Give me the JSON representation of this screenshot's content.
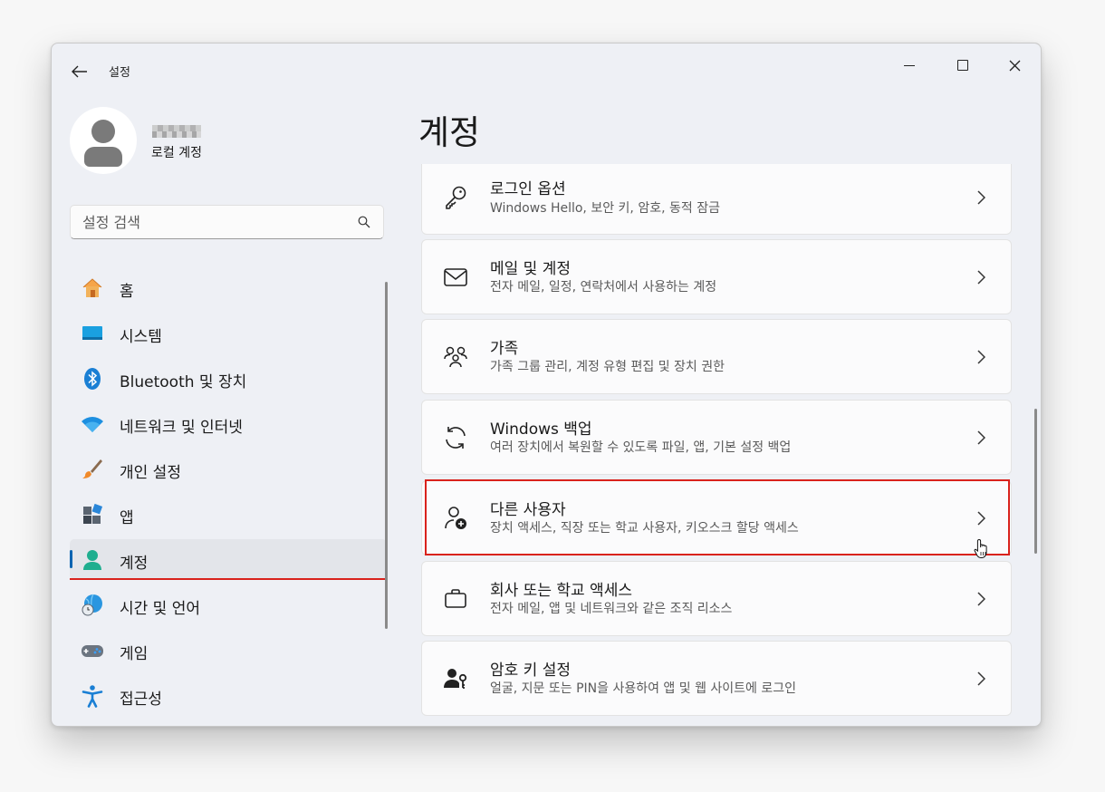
{
  "window": {
    "title": "설정"
  },
  "profile": {
    "account_type": "로컬 계정"
  },
  "search": {
    "placeholder": "설정 검색"
  },
  "nav": {
    "items": [
      {
        "label": "홈",
        "icon": "home-icon"
      },
      {
        "label": "시스템",
        "icon": "system-icon"
      },
      {
        "label": "Bluetooth 및 장치",
        "icon": "bluetooth-icon"
      },
      {
        "label": "네트워크 및 인터넷",
        "icon": "wifi-icon"
      },
      {
        "label": "개인 설정",
        "icon": "brush-icon"
      },
      {
        "label": "앱",
        "icon": "apps-icon"
      },
      {
        "label": "계정",
        "icon": "account-icon"
      },
      {
        "label": "시간 및 언어",
        "icon": "globe-clock-icon"
      },
      {
        "label": "게임",
        "icon": "gamepad-icon"
      },
      {
        "label": "접근성",
        "icon": "accessibility-icon"
      }
    ],
    "selected": "계정"
  },
  "page": {
    "title": "계정"
  },
  "cards": [
    {
      "title": "로그인 옵션",
      "subtitle": "Windows Hello, 보안 키, 암호, 동적 잠금",
      "icon": "key-icon"
    },
    {
      "title": "메일 및 계정",
      "subtitle": "전자 메일, 일정, 연락처에서 사용하는 계정",
      "icon": "mail-icon"
    },
    {
      "title": "가족",
      "subtitle": "가족 그룹 관리, 계정 유형 편집 및 장치 권한",
      "icon": "family-icon"
    },
    {
      "title": "Windows 백업",
      "subtitle": "여러 장치에서 복원할 수 있도록 파일, 앱, 기본 설정 백업",
      "icon": "sync-icon"
    },
    {
      "title": "다른 사용자",
      "subtitle": "장치 액세스, 직장 또는 학교 사용자, 키오스크 할당 액세스",
      "icon": "add-user-icon"
    },
    {
      "title": "회사 또는 학교 액세스",
      "subtitle": "전자 메일, 앱 및 네트워크와 같은 조직 리소스",
      "icon": "briefcase-icon"
    },
    {
      "title": "암호 키 설정",
      "subtitle": "얼굴, 지문 또는 PIN을 사용하여 앱 및 웹 사이트에 로그인",
      "icon": "passkey-icon"
    }
  ],
  "colors": {
    "accent": "#0063b1",
    "highlight": "#d9221c"
  }
}
